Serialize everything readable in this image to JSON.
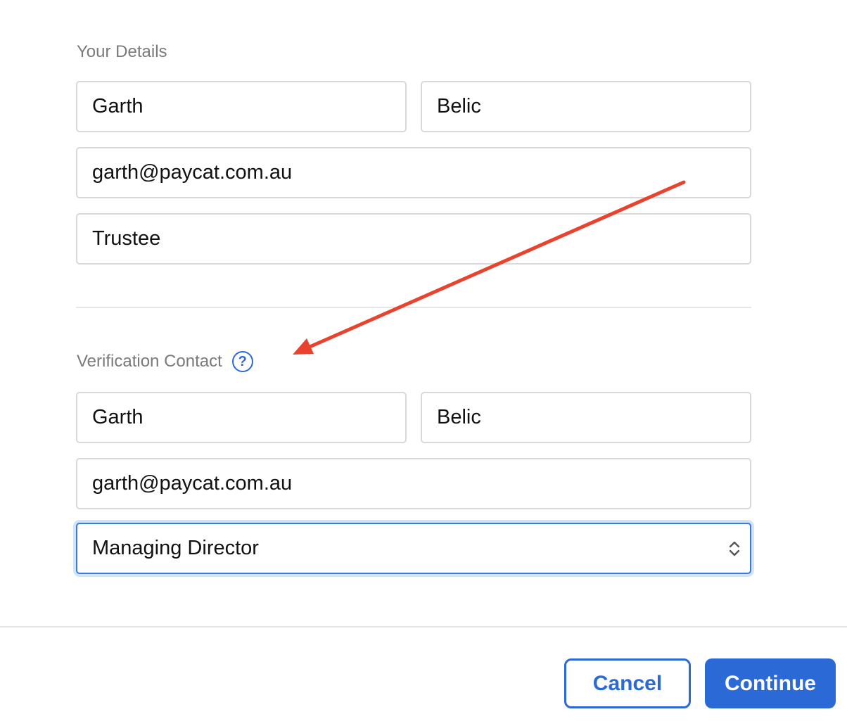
{
  "your_details": {
    "heading": "Your Details",
    "first_name": "Garth",
    "last_name": "Belic",
    "email": "garth@paycat.com.au",
    "role": "Trustee"
  },
  "verification_contact": {
    "heading": "Verification Contact",
    "help_icon_glyph": "?",
    "first_name": "Garth",
    "last_name": "Belic",
    "email": "garth@paycat.com.au",
    "role_selected": "Managing Director"
  },
  "footer": {
    "cancel_label": "Cancel",
    "continue_label": "Continue"
  },
  "colors": {
    "accent": "#2b6ad6",
    "annotation_arrow": "#e8432e"
  }
}
